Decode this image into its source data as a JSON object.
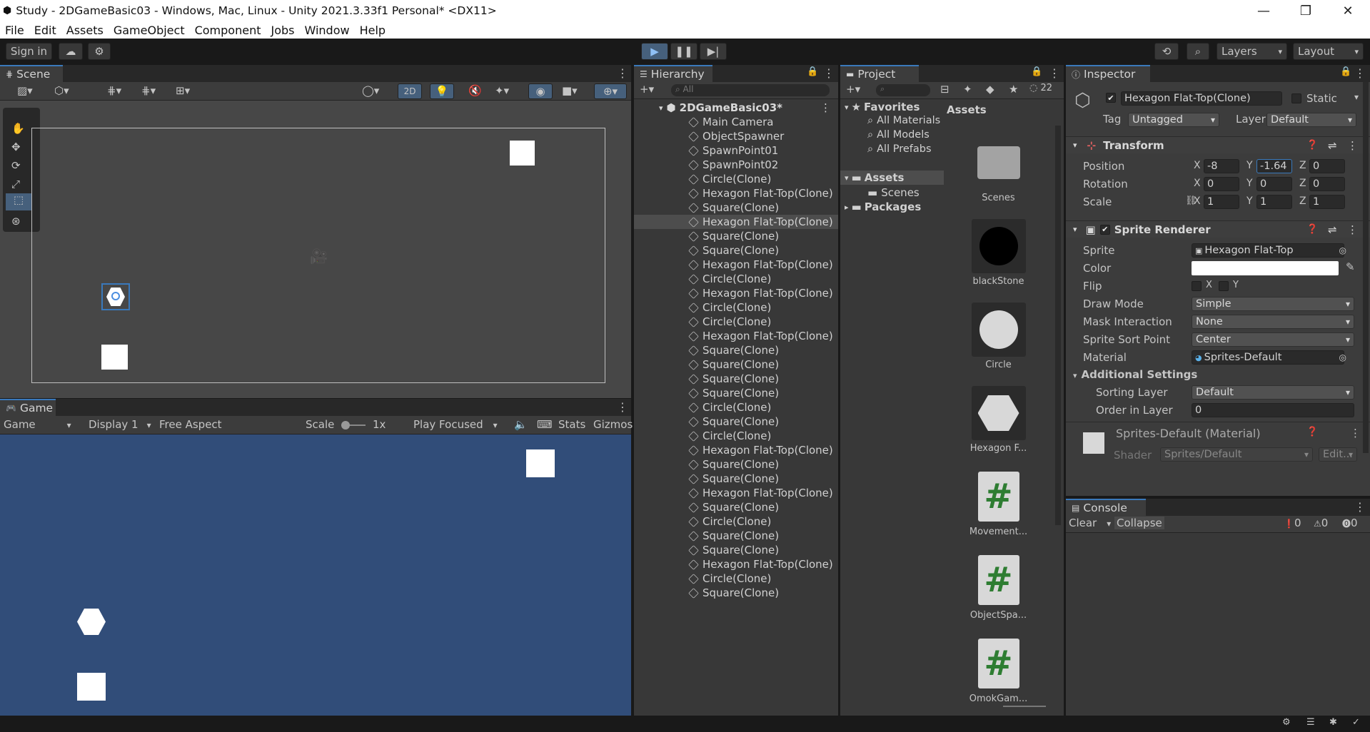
{
  "window": {
    "title": "Study - 2DGameBasic03 - Windows, Mac, Linux - Unity 2021.3.33f1 Personal* <DX11>"
  },
  "menu": [
    "File",
    "Edit",
    "Assets",
    "GameObject",
    "Component",
    "Jobs",
    "Window",
    "Help"
  ],
  "toolbar": {
    "sign_in": "Sign in",
    "layers": "Layers",
    "layout": "Layout"
  },
  "scene": {
    "tab": "Scene",
    "mode_2d": "2D"
  },
  "game": {
    "tab": "Game",
    "view": "Game",
    "display": "Display 1",
    "aspect": "Free Aspect",
    "scale_label": "Scale",
    "scale_value": "1x",
    "play_focused": "Play Focused",
    "stats": "Stats",
    "gizmos": "Gizmos"
  },
  "hierarchy": {
    "tab": "Hierarchy",
    "search_placeholder": "All",
    "scene": "2DGameBasic03*",
    "items": [
      "Main Camera",
      "ObjectSpawner",
      "SpawnPoint01",
      "SpawnPoint02",
      "Circle(Clone)",
      "Hexagon Flat-Top(Clone)",
      "Square(Clone)",
      "Hexagon Flat-Top(Clone)",
      "Square(Clone)",
      "Square(Clone)",
      "Hexagon Flat-Top(Clone)",
      "Circle(Clone)",
      "Hexagon Flat-Top(Clone)",
      "Circle(Clone)",
      "Circle(Clone)",
      "Hexagon Flat-Top(Clone)",
      "Square(Clone)",
      "Square(Clone)",
      "Square(Clone)",
      "Square(Clone)",
      "Circle(Clone)",
      "Square(Clone)",
      "Circle(Clone)",
      "Hexagon Flat-Top(Clone)",
      "Square(Clone)",
      "Square(Clone)",
      "Hexagon Flat-Top(Clone)",
      "Square(Clone)",
      "Circle(Clone)",
      "Square(Clone)",
      "Square(Clone)",
      "Hexagon Flat-Top(Clone)",
      "Circle(Clone)",
      "Square(Clone)"
    ],
    "selected_index": 7
  },
  "project": {
    "tab": "Project",
    "hidden_count": "22",
    "favorites": "Favorites",
    "fav_items": [
      "All Materials",
      "All Models",
      "All Prefabs"
    ],
    "assets": "Assets",
    "scenes": "Scenes",
    "packages": "Packages",
    "breadcrumb": "Assets",
    "asset_items": [
      {
        "name": "Scenes",
        "kind": "folder"
      },
      {
        "name": "blackStone",
        "kind": "black"
      },
      {
        "name": "Circle",
        "kind": "circle"
      },
      {
        "name": "Hexagon F...",
        "kind": "hex"
      },
      {
        "name": "Movement...",
        "kind": "script"
      },
      {
        "name": "ObjectSpa...",
        "kind": "script"
      },
      {
        "name": "OmokGam...",
        "kind": "script"
      }
    ]
  },
  "inspector": {
    "tab": "Inspector",
    "object_name": "Hexagon Flat-Top(Clone)",
    "static": "Static",
    "tag_label": "Tag",
    "tag": "Untagged",
    "layer_label": "Layer",
    "layer": "Default",
    "transform": {
      "title": "Transform",
      "position_label": "Position",
      "rotation_label": "Rotation",
      "scale_label": "Scale",
      "position": [
        "-8",
        "-1.64",
        "0"
      ],
      "rotation": [
        "0",
        "0",
        "0"
      ],
      "scale": [
        "1",
        "1",
        "1"
      ],
      "x": "X",
      "y": "Y",
      "z": "Z"
    },
    "sprite_renderer": {
      "title": "Sprite Renderer",
      "sprite_label": "Sprite",
      "sprite": "Hexagon Flat-Top",
      "color_label": "Color",
      "color": "#ffffff",
      "flip_label": "Flip",
      "draw_mode_label": "Draw Mode",
      "draw_mode": "Simple",
      "mask_label": "Mask Interaction",
      "mask": "None",
      "sort_point_label": "Sprite Sort Point",
      "sort_point": "Center",
      "material_label": "Material",
      "material": "Sprites-Default",
      "additional": "Additional Settings",
      "sorting_layer_label": "Sorting Layer",
      "sorting_layer": "Default",
      "order_label": "Order in Layer",
      "order": "0"
    },
    "material": {
      "title": "Sprites-Default (Material)",
      "shader_label": "Shader",
      "shader": "Sprites/Default",
      "edit": "Edit..."
    }
  },
  "console": {
    "tab": "Console",
    "clear": "Clear",
    "collapse": "Collapse",
    "logs": "0",
    "warnings": "0",
    "errors": "0"
  },
  "colors": {
    "accent": "#3a79bb",
    "game_bg": "#314d79",
    "scene_bg": "#474747",
    "selection": "#4d4d4d"
  }
}
